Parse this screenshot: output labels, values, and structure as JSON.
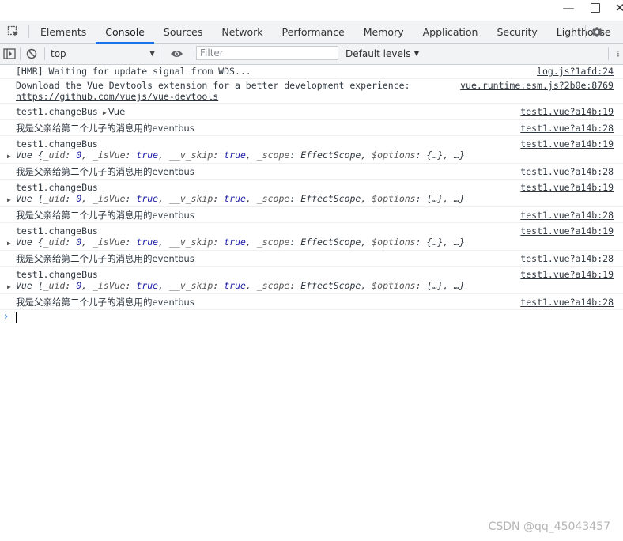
{
  "window": {
    "minimize_label": "—",
    "close_label": "✕"
  },
  "tabs": [
    {
      "label": "Elements"
    },
    {
      "label": "Console",
      "active": true
    },
    {
      "label": "Sources"
    },
    {
      "label": "Network"
    },
    {
      "label": "Performance"
    },
    {
      "label": "Memory"
    },
    {
      "label": "Application"
    },
    {
      "label": "Security"
    },
    {
      "label": "Lighthouse"
    }
  ],
  "toolbar": {
    "context": "top",
    "filter_placeholder": "Filter",
    "levels_label": "Default levels"
  },
  "messages": [
    {
      "text": "[HMR] Waiting for update signal from WDS...",
      "source": "log.js?1afd:24"
    },
    {
      "text": "Download the Vue Devtools extension for a better development experience:",
      "link": "https://github.com/vuejs/vue-devtools",
      "source": "vue.runtime.esm.js?2b0e:8769"
    },
    {
      "text": "test1.changeBus",
      "inline_obj": "Vue",
      "source": "test1.vue?a14b:19"
    },
    {
      "text": "我是父亲给第二个儿子的消息用的eventbus",
      "source": "test1.vue?a14b:28"
    },
    {
      "text": "test1.changeBus",
      "source": "test1.vue?a14b:19"
    },
    {
      "text": "我是父亲给第二个儿子的消息用的eventbus",
      "source": "test1.vue?a14b:28"
    },
    {
      "text": "test1.changeBus",
      "source": "test1.vue?a14b:19"
    },
    {
      "text": "我是父亲给第二个儿子的消息用的eventbus",
      "source": "test1.vue?a14b:28"
    },
    {
      "text": "test1.changeBus",
      "source": "test1.vue?a14b:19"
    },
    {
      "text": "我是父亲给第二个儿子的消息用的eventbus",
      "source": "test1.vue?a14b:28"
    },
    {
      "text": "test1.changeBus",
      "source": "test1.vue?a14b:19"
    },
    {
      "text": "我是父亲给第二个儿子的消息用的eventbus",
      "source": "test1.vue?a14b:28"
    }
  ],
  "vue_object": {
    "name": "Vue",
    "k1": "_uid",
    "v1": "0",
    "k2": "_isVue",
    "v2": "true",
    "k3": "__v_skip",
    "v3": "true",
    "k4": "_scope",
    "v4": "EffectScope",
    "k5": "$options",
    "v5": "{…}",
    "tail": "…"
  },
  "watermark": "CSDN @qq_45043457"
}
